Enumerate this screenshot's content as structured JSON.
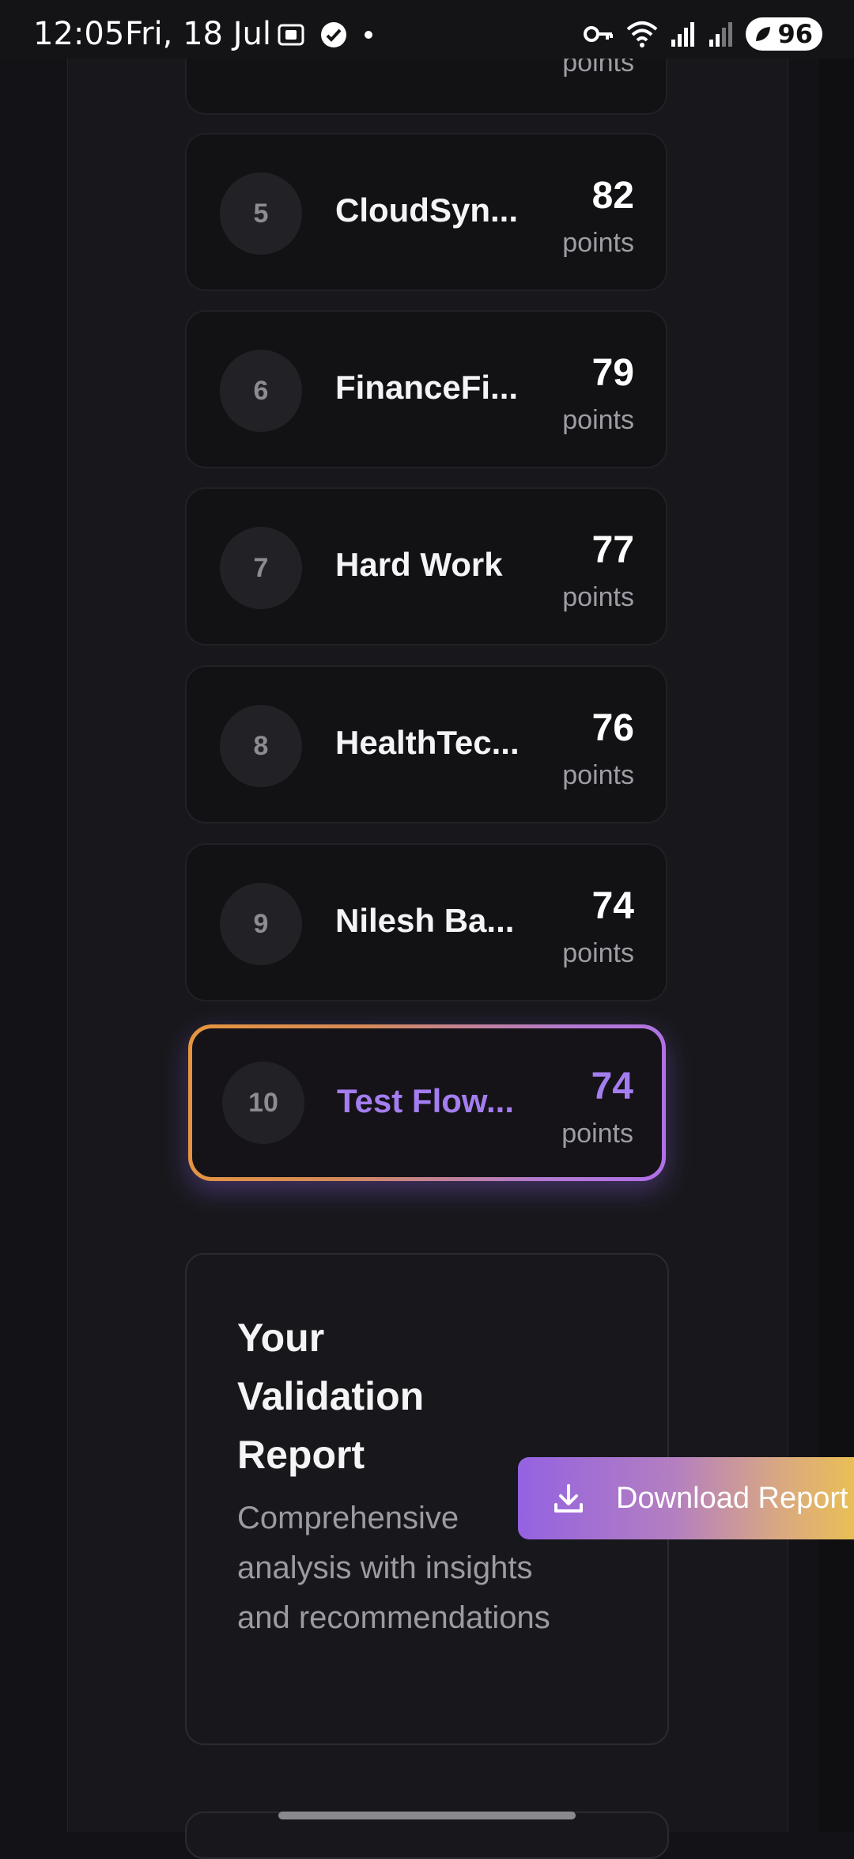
{
  "status_bar": {
    "time": "12:05",
    "date": "Fri, 18 Jul",
    "battery": "96"
  },
  "leaderboard": {
    "points_label": "points",
    "partial_top_unit": "points",
    "entries": [
      {
        "rank": "5",
        "name": "CloudSyn...",
        "score": "82",
        "unit": "points"
      },
      {
        "rank": "6",
        "name": "FinanceFi...",
        "score": "79",
        "unit": "points"
      },
      {
        "rank": "7",
        "name": "Hard Work",
        "score": "77",
        "unit": "points"
      },
      {
        "rank": "8",
        "name": "HealthTec...",
        "score": "76",
        "unit": "points"
      },
      {
        "rank": "9",
        "name": "Nilesh Ba...",
        "score": "74",
        "unit": "points"
      }
    ],
    "current_user": {
      "rank": "10",
      "name": "Test Flow...",
      "score": "74",
      "unit": "points"
    }
  },
  "report": {
    "title": "Your Validation Report",
    "description": "Comprehensive analysis with insights and recommendations",
    "download_label": "Download Report"
  },
  "colors": {
    "background": "#131317",
    "card": "#121215",
    "accent_purple": "#a47df0",
    "accent_orange": "#e6953e",
    "button_gradient_start": "#9462e2",
    "button_gradient_end": "#ecc24e"
  }
}
